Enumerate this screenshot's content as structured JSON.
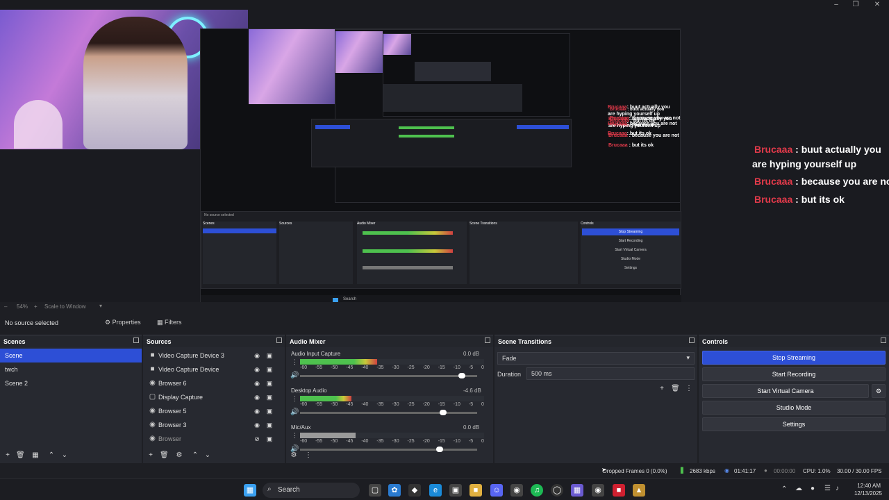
{
  "preview": {
    "chat": [
      {
        "user": "Brucaaa",
        "text": ": buut actually you"
      },
      {
        "user": "",
        "text": "are hyping yourself up"
      },
      {
        "user": "Brucaaa",
        "text": ": because you are not"
      },
      {
        "user": "Brucaaa",
        "text": ": but its ok"
      }
    ],
    "inner_labels": {
      "no_source": "No source selected",
      "properties": "Properties",
      "filters": "Filters",
      "scenes": "Scenes",
      "sources": "Sources",
      "audio_mixer": "Audio Mixer",
      "scene_transitions": "Scene Transitions",
      "controls": "Controls",
      "stop_streaming": "Stop Streaming",
      "start_recording": "Start Recording",
      "start_virtual_camera": "Start Virtual Camera",
      "studio_mode": "Studio Mode",
      "settings": "Settings",
      "search": "Search"
    }
  },
  "status_row": {
    "zoom": "54%",
    "scale": "Scale to Window"
  },
  "toolbar": {
    "no_source": "No source selected",
    "properties": "Properties",
    "filters": "Filters"
  },
  "scenes": {
    "title": "Scenes",
    "items": [
      "Scene",
      "twch",
      "Scene 2"
    ],
    "selected": 0
  },
  "sources": {
    "title": "Sources",
    "items": [
      {
        "name": "Video Capture Device 3",
        "icon": "camera-icon"
      },
      {
        "name": "Video Capture Device",
        "icon": "camera-icon"
      },
      {
        "name": "Browser 6",
        "icon": "globe-icon"
      },
      {
        "name": "Display Capture",
        "icon": "monitor-icon"
      },
      {
        "name": "Browser 5",
        "icon": "globe-icon"
      },
      {
        "name": "Browser 3",
        "icon": "globe-icon"
      },
      {
        "name": "Browser",
        "icon": "globe-icon"
      }
    ]
  },
  "mixer": {
    "title": "Audio Mixer",
    "tick_labels": [
      "-60",
      "-55",
      "-50",
      "-45",
      "-40",
      "-35",
      "-30",
      "-25",
      "-20",
      "-15",
      "-10",
      "-5",
      "0"
    ],
    "channels": [
      {
        "name": "Audio Input Capture",
        "db": "0.0 dB",
        "level": 0.42,
        "fader": 0.93
      },
      {
        "name": "Desktop Audio",
        "db": "-4.6 dB",
        "level": 0.28,
        "fader": 0.82
      },
      {
        "name": "Mic/Aux",
        "db": "0.0 dB",
        "level": 0.3,
        "fader": 0.8
      }
    ]
  },
  "transitions": {
    "title": "Scene Transitions",
    "type": "Fade",
    "duration_label": "Duration",
    "duration": "500 ms"
  },
  "controls": {
    "title": "Controls",
    "stop_streaming": "Stop Streaming",
    "start_recording": "Start Recording",
    "start_virtual_camera": "Start Virtual Camera",
    "studio_mode": "Studio Mode",
    "settings": "Settings"
  },
  "statusbar": {
    "dropped": "Dropped Frames 0 (0.0%)",
    "bitrate": "2683 kbps",
    "live_time": "01:41:17",
    "rec_time": "00:00:00",
    "cpu": "CPU: 1.0%",
    "fps": "30.00 / 30.00 FPS"
  },
  "taskbar": {
    "search": "Search",
    "time": "12:40 AM",
    "date": "12/13/2025"
  },
  "colors": {
    "accent": "#2d4fd6",
    "chat_user": "#e23a4a",
    "meter_green": "#4ec14e"
  }
}
